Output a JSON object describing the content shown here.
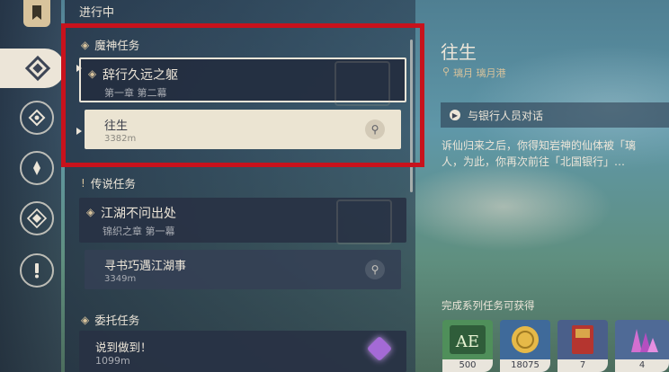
{
  "panel": {
    "title": "进行中"
  },
  "sections": {
    "archon": {
      "label": "魔神任务"
    },
    "legend": {
      "label": "传说任务"
    },
    "commission": {
      "label": "委托任务"
    }
  },
  "quests": {
    "archon": {
      "name": "辞行久远之躯",
      "chapter": "第一章 第二幕"
    },
    "archon_step": {
      "name": "往生",
      "distance": "3382m"
    },
    "legend": {
      "name": "江湖不问出处",
      "chapter": "锦织之章 第一幕"
    },
    "legend_step": {
      "name": "寻书巧遇江湖事",
      "distance": "3349m"
    },
    "commission": {
      "name": "说到做到！",
      "distance": "1099m"
    }
  },
  "detail": {
    "title": "往生",
    "location": "璃月 璃月港",
    "objective": "与银行人员对话",
    "description_line1": "诉仙归来之后，你得知岩神的仙体被「璃",
    "description_line2": "人，为此，你再次前往「北国银行」…"
  },
  "rewards": {
    "title": "完成系列任务可获得",
    "items": [
      {
        "icon": "adventure-exp-icon",
        "count": "500",
        "color": "#4f8f5a"
      },
      {
        "icon": "mora-coin-icon",
        "count": "18075",
        "color": "#3f6a9a"
      },
      {
        "icon": "weapon-ascension-book-icon",
        "count": "7",
        "color": "#4a5f8a"
      },
      {
        "icon": "crystal-ore-icon",
        "count": "4",
        "color": "#4f6a96"
      }
    ]
  },
  "colors": {
    "highlight_red": "#c8121c",
    "panel_cream": "#ece5d8",
    "accent_gold": "#d8c39c"
  }
}
